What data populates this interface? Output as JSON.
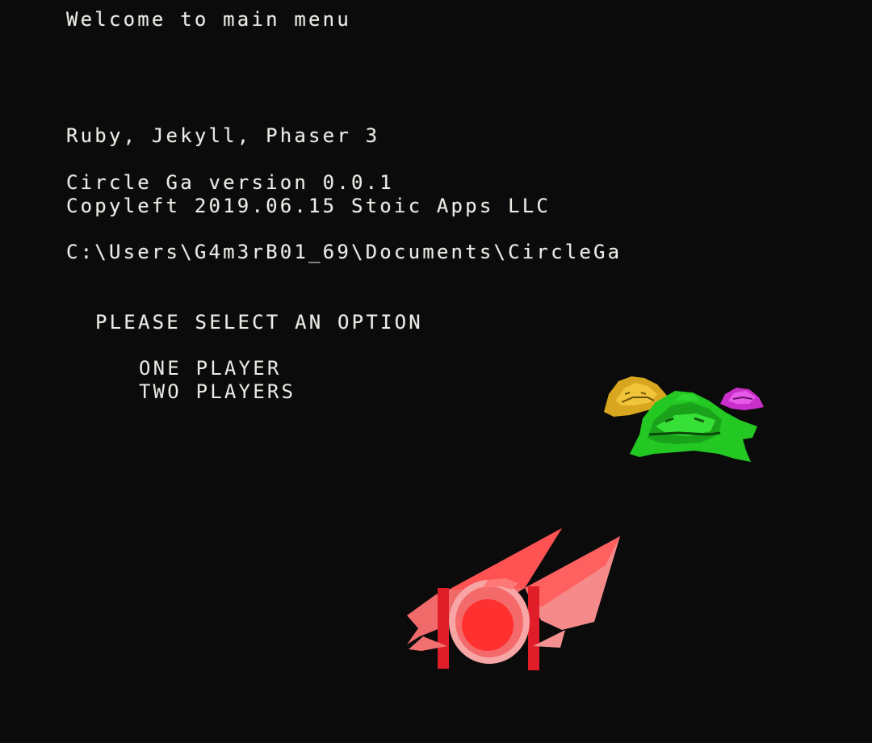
{
  "header": {
    "welcome": "Welcome to main menu",
    "tech": "Ruby, Jekyll, Phaser 3",
    "version": "Circle Ga version 0.0.1",
    "copyright": "Copyleft 2019.06.15 Stoic Apps LLC",
    "path": "C:\\Users\\G4m3rB01_69\\Documents\\CircleGa"
  },
  "menu": {
    "prompt": "PLEASE SELECT AN OPTION",
    "options": [
      {
        "label": "ONE PLAYER"
      },
      {
        "label": "TWO PLAYERS"
      }
    ]
  },
  "sprites": {
    "enemies": [
      {
        "name": "yellow-alien",
        "color": "#e6b526"
      },
      {
        "name": "green-alien",
        "color": "#2fd82f"
      },
      {
        "name": "magenta-alien",
        "color": "#d63bd6"
      }
    ],
    "player": {
      "name": "red-fighter-ship",
      "color": "#f23a3a"
    }
  },
  "colors": {
    "background": "#0b0b0b",
    "text": "#ecebe6"
  }
}
